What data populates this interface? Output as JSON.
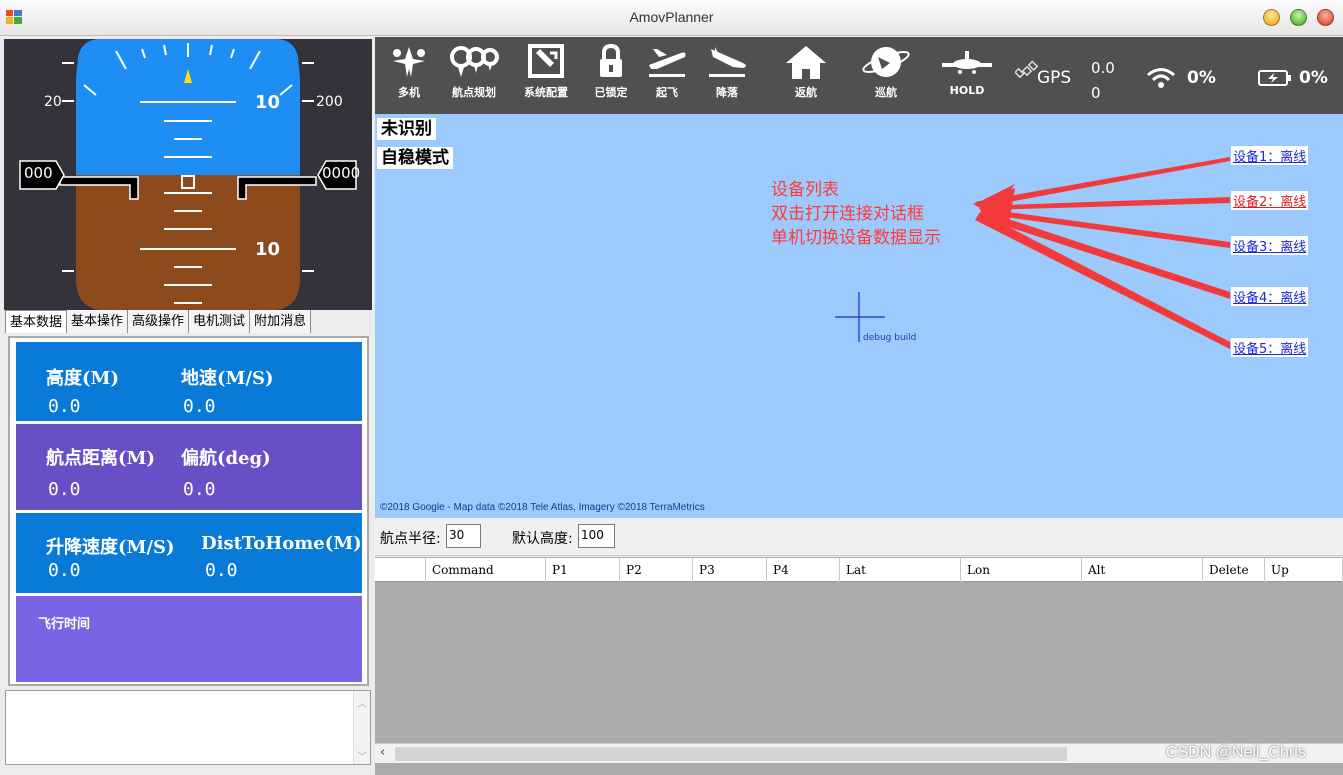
{
  "window": {
    "title": "AmovPlanner"
  },
  "hud": {
    "scale_left": "20",
    "scale_right": "200",
    "pitch_upper": "10",
    "pitch_lower": "10",
    "speed_box": "000",
    "alt_box": "0000"
  },
  "tabs": [
    "基本数据",
    "基本操作",
    "高级操作",
    "电机测试",
    "附加消息"
  ],
  "stats": {
    "altitude_label": "高度(M)",
    "altitude_value": "0.0",
    "ground_speed_label": "地速(M/S)",
    "ground_speed_value": "0.0",
    "wp_distance_label": "航点距离(M)",
    "wp_distance_value": "0.0",
    "yaw_label": "偏航(deg)",
    "yaw_value": "0.0",
    "climb_rate_label": "升降速度(M/S)",
    "climb_rate_value": "0.0",
    "dist_home_label": "DistToHome(M)",
    "dist_home_value": "0.0",
    "flight_time_label": "飞行时间"
  },
  "toolbar": {
    "buttons": [
      {
        "label": "多机",
        "icon": "multi-drone-icon"
      },
      {
        "label": "航点规划",
        "icon": "waypoint-plan-icon"
      },
      {
        "label": "系统配置",
        "icon": "system-config-icon"
      },
      {
        "label": "已锁定",
        "icon": "lock-icon"
      },
      {
        "label": "起飞",
        "icon": "takeoff-icon"
      },
      {
        "label": "降落",
        "icon": "landing-icon"
      },
      {
        "label": "返航",
        "icon": "home-icon"
      },
      {
        "label": "巡航",
        "icon": "cruise-icon"
      },
      {
        "label": "HOLD",
        "icon": "hold-icon"
      }
    ],
    "gps_label": "GPS",
    "gps_value_top": "0.0",
    "gps_value_bottom": "0",
    "signal_value": "0%",
    "battery_value": "0%"
  },
  "map": {
    "mode_primary": "未识别",
    "mode_secondary": "自稳模式",
    "devices": [
      "设备1：离线",
      "设备2：离线",
      "设备3：离线",
      "设备4：离线",
      "设备5：离线"
    ],
    "annotation": [
      "设备列表",
      "双击打开连接对话框",
      "单机切换设备数据显示"
    ],
    "debug_text": "debug build",
    "attribution": "©2018 Google - Map data ©2018 Tele Atlas, Imagery ©2018 TerraMetrics"
  },
  "settings": {
    "wp_radius_label": "航点半径:",
    "wp_radius_value": "30",
    "default_alt_label": "默认高度:",
    "default_alt_value": "100"
  },
  "grid": {
    "columns": [
      "",
      "Command",
      "P1",
      "P2",
      "P3",
      "P4",
      "Lat",
      "Lon",
      "Alt",
      "Delete",
      "Up"
    ]
  },
  "watermark": "CSDN @Neil_Chris",
  "colors": {
    "sky": "#1e8ef5",
    "ground": "#8d4a1d",
    "hud_bg": "#34323b",
    "toolbar_bg": "#505050",
    "map_bg": "#9ccafd",
    "stat_blue": "#0a7ad8",
    "stat_purple": "#6750c6",
    "annotation_red": "#ff3a3a"
  }
}
